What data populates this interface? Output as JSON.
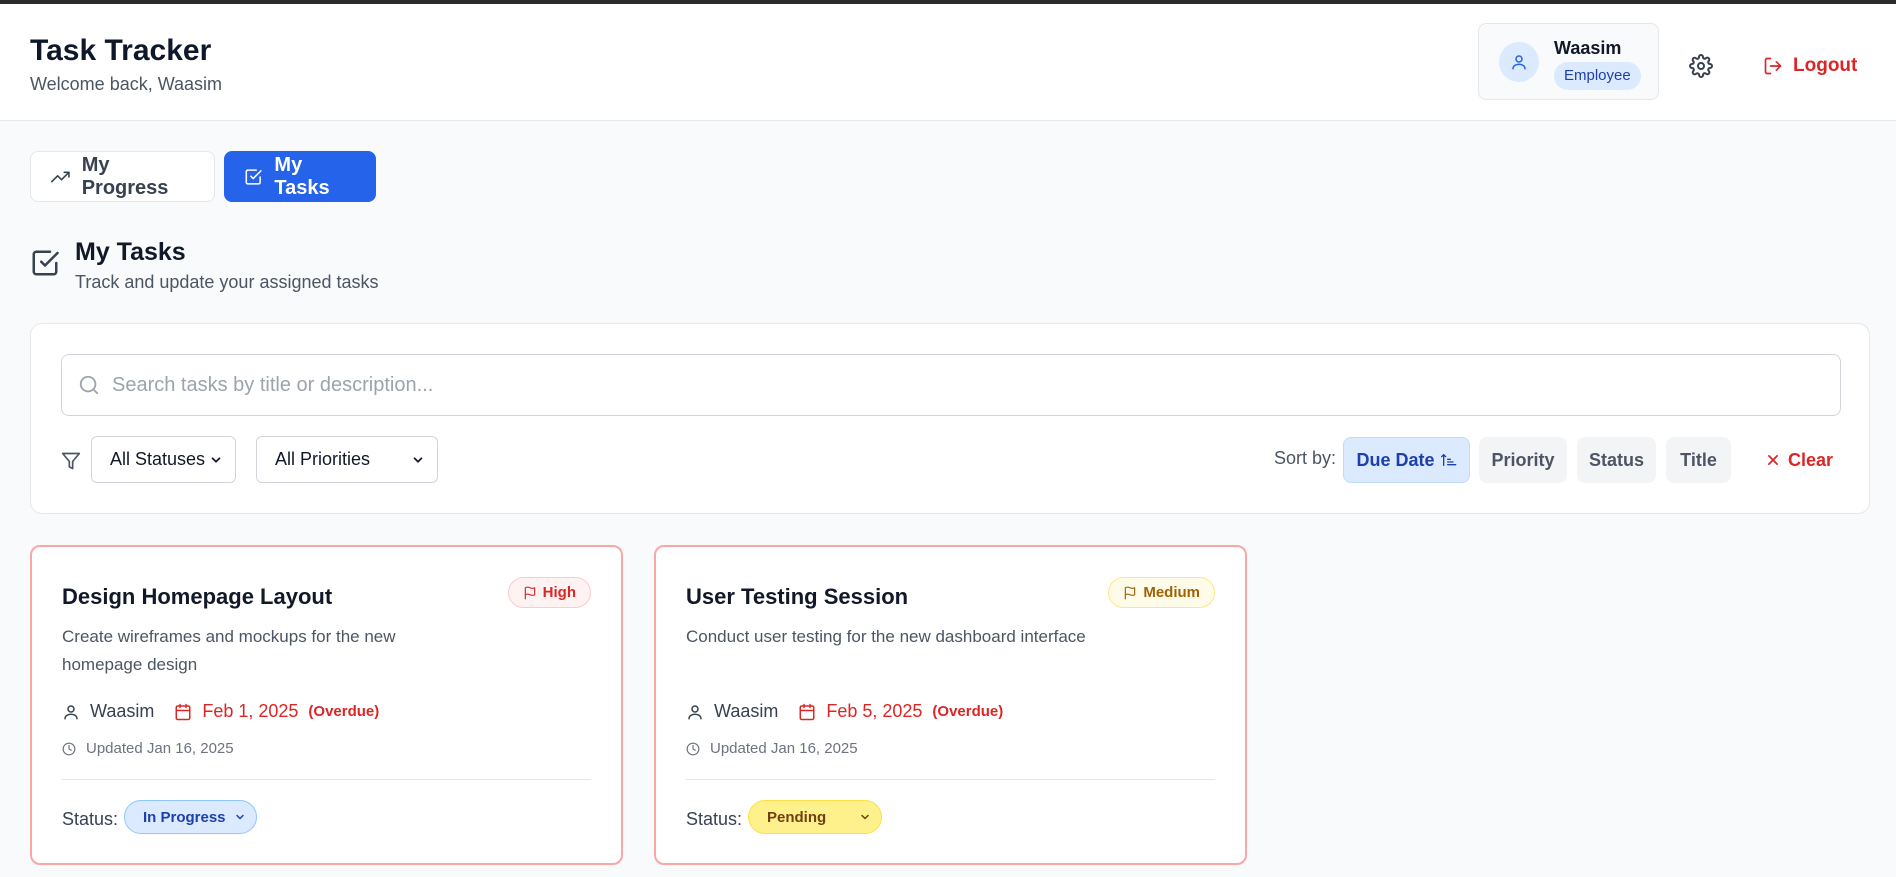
{
  "header": {
    "title": "Task Tracker",
    "subtitle": "Welcome back, Waasim",
    "user": {
      "name": "Waasim",
      "role": "Employee"
    },
    "logout_label": "Logout"
  },
  "tabs": [
    {
      "label": "My Progress",
      "active": false
    },
    {
      "label": "My Tasks",
      "active": true
    }
  ],
  "section": {
    "title": "My Tasks",
    "subtitle": "Track and update your assigned tasks"
  },
  "filters": {
    "search_placeholder": "Search tasks by title or description...",
    "status_select": "All Statuses",
    "priority_select": "All Priorities",
    "sort_label": "Sort by:",
    "sort_options": [
      "Due Date",
      "Priority",
      "Status",
      "Title"
    ],
    "active_sort": "Due Date",
    "clear_label": "Clear"
  },
  "tasks": [
    {
      "title": "Design Homepage Layout",
      "priority": "High",
      "description": "Create wireframes and mockups for the new homepage design",
      "assignee": "Waasim",
      "due": "Feb 1, 2025",
      "overdue": "(Overdue)",
      "updated": "Updated Jan 16, 2025",
      "status_label": "Status:",
      "status": "In Progress"
    },
    {
      "title": "User Testing Session",
      "priority": "Medium",
      "description": "Conduct user testing for the new dashboard interface",
      "assignee": "Waasim",
      "due": "Feb 5, 2025",
      "overdue": "(Overdue)",
      "updated": "Updated Jan 16, 2025",
      "status_label": "Status:",
      "status": "Pending"
    }
  ],
  "colors": {
    "primary": "#2563eb",
    "danger": "#dc2626",
    "overdue_border": "#fca5a5",
    "in_progress_bg": "#dbeafe",
    "pending_bg": "#fef08a"
  }
}
